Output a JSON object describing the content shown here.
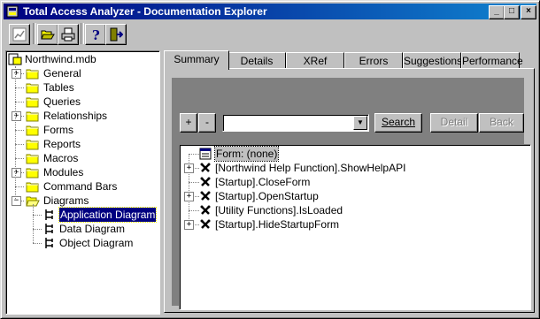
{
  "window": {
    "title": "Total Access Analyzer - Documentation Explorer"
  },
  "title_buttons": {
    "minimize": "_",
    "maximize": "□",
    "close": "×"
  },
  "toolbar": {
    "items": [
      {
        "icon": "chart-icon"
      },
      {
        "icon": "open-folder-icon"
      },
      {
        "icon": "print-icon"
      },
      {
        "icon": "help-icon"
      },
      {
        "icon": "exit-icon"
      }
    ]
  },
  "tree": {
    "root": "Northwind.mdb",
    "items": [
      {
        "label": "General",
        "expandable": true,
        "expanded": false
      },
      {
        "label": "Tables",
        "expandable": false
      },
      {
        "label": "Queries",
        "expandable": false
      },
      {
        "label": "Relationships",
        "expandable": true,
        "expanded": false
      },
      {
        "label": "Forms",
        "expandable": false
      },
      {
        "label": "Reports",
        "expandable": false
      },
      {
        "label": "Macros",
        "expandable": false
      },
      {
        "label": "Modules",
        "expandable": true,
        "expanded": false
      },
      {
        "label": "Command Bars",
        "expandable": false
      },
      {
        "label": "Diagrams",
        "expandable": true,
        "expanded": true
      }
    ],
    "diagram_children": [
      "Application Diagram",
      "Data Diagram",
      "Object Diagram"
    ],
    "expander_plus": "+",
    "expander_minus": "−"
  },
  "tabs": [
    "Summary",
    "Details",
    "XRef",
    "Errors",
    "Suggestions",
    "Performance"
  ],
  "controls": {
    "plus": "+",
    "minus": "-",
    "combo_value": "",
    "combo_arrow": "▼",
    "search": "Search",
    "detail": "Detail",
    "back": "Back"
  },
  "list": {
    "items": [
      {
        "label": "Form: (none)",
        "icon": "form-icon",
        "expandable": false
      },
      {
        "label": "[Northwind Help Function].ShowHelpAPI",
        "icon": "function-icon",
        "expandable": true
      },
      {
        "label": "[Startup].CloseForm",
        "icon": "function-icon",
        "expandable": false
      },
      {
        "label": "[Startup].OpenStartup",
        "icon": "function-icon",
        "expandable": true
      },
      {
        "label": "[Utility Functions].IsLoaded",
        "icon": "function-icon",
        "expandable": false
      },
      {
        "label": "[Startup].HideStartupForm",
        "icon": "function-icon",
        "expandable": true
      }
    ]
  }
}
